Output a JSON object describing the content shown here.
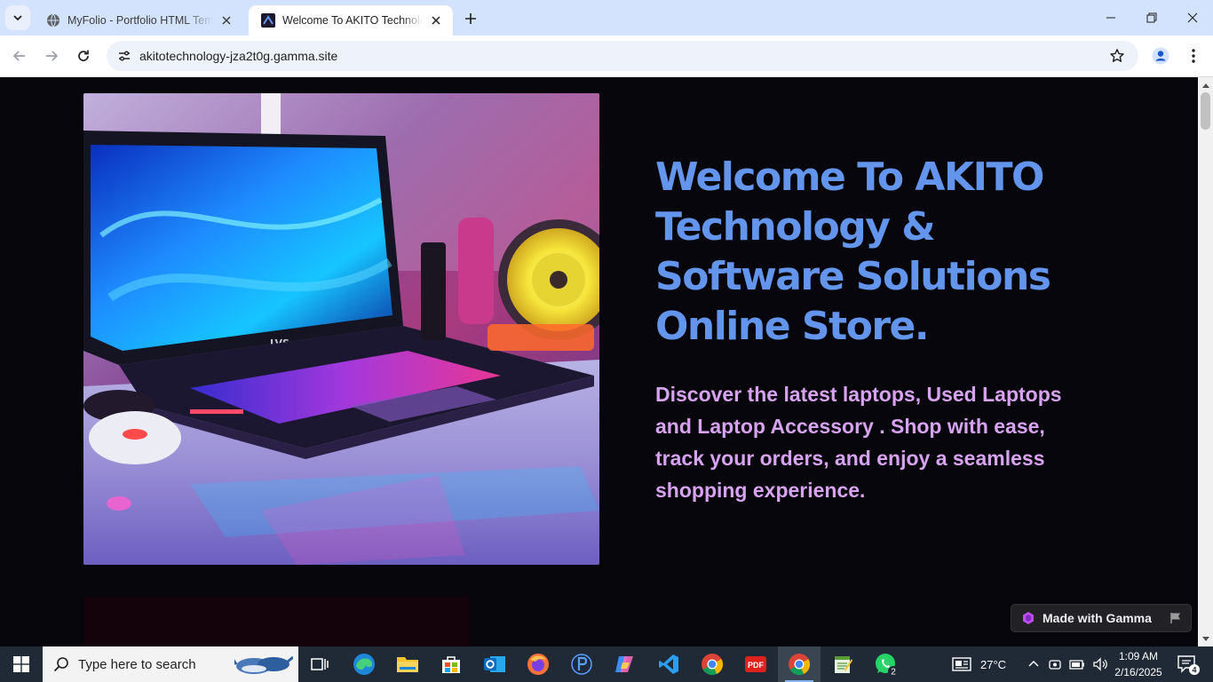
{
  "browser": {
    "tabs": [
      {
        "title": "MyFolio - Portfolio HTML Template",
        "active": false
      },
      {
        "title": "Welcome To AKITO Technology & Software Solutions Online Store.",
        "active": true
      }
    ],
    "url": "akitotechnology-jza2t0g.gamma.site"
  },
  "page": {
    "hero_title": "Welcome To AKITO Technology & Software Solutions Online Store.",
    "hero_description": "Discover the latest laptops, Used Laptops and Laptop Accessory . Shop with ease, track your orders, and enjoy a seamless shopping experience.",
    "laptop_brand": "LVS",
    "badge_label": "Made with Gamma"
  },
  "taskbar": {
    "search_placeholder": "Type here to search",
    "whatsapp_badge": "2",
    "weather": "27°C",
    "time": "1:09 AM",
    "date": "2/16/2025",
    "notification_count": "4"
  },
  "colors": {
    "title": "#6495ec",
    "description": "#d7a2f0",
    "page_bg": "#07060c",
    "tabbar": "#d3e3fd"
  }
}
